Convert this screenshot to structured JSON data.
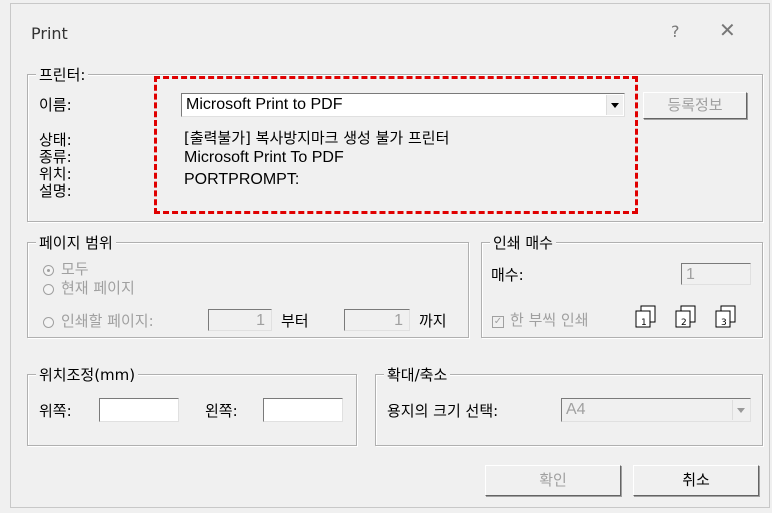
{
  "title": "Print",
  "title_buttons": {
    "help": "?",
    "close": "✕"
  },
  "printer": {
    "legend": "프린터:",
    "name_label": "이름:",
    "name_value": "Microsoft Print to PDF",
    "register_button": "등록정보",
    "status_label": "상태:",
    "status_value": "[출력불가] 복사방지마크 생성 불가 프린터",
    "type_label": "종류:",
    "type_value": "Microsoft Print To PDF",
    "location_label": "위치:",
    "location_value": "PORTPROMPT:",
    "comment_label": "설명:"
  },
  "page_range": {
    "legend": "페이지 범위",
    "all": "모두",
    "current": "현재 페이지",
    "pages": "인쇄할 페이지:",
    "from_value": "1",
    "from_label": "부터",
    "to_value": "1",
    "to_label": "까지"
  },
  "copies": {
    "legend": "인쇄 매수",
    "count_label": "매수:",
    "count_value": "1",
    "collate_label": "한 부씩 인쇄",
    "collate_mark": "✓",
    "icon_labels": [
      "1",
      "2",
      "3"
    ]
  },
  "position": {
    "legend": "위치조정(mm)",
    "top_label": "위쪽:",
    "left_label": "왼쪽:"
  },
  "scale": {
    "legend": "확대/축소",
    "paper_label": "용지의 크기 선택:",
    "paper_value": "A4"
  },
  "buttons": {
    "ok": "확인",
    "cancel": "취소"
  },
  "colors": {
    "annotation": "#e00000",
    "disabled_text": "#a0a0a0"
  },
  "icons": {
    "radio_on": "radio-selected-icon",
    "copy": "collate-copy-icon"
  }
}
